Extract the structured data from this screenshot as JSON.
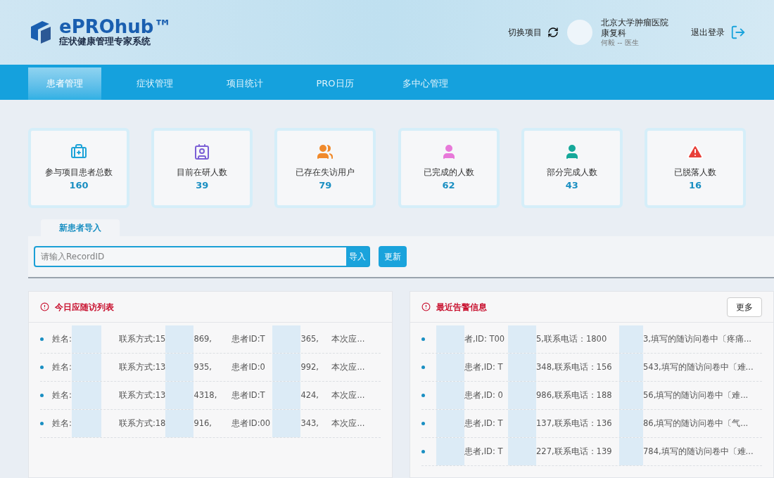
{
  "header": {
    "logo_title": "ePROhub™",
    "logo_subtitle": "症状健康管理专家系统",
    "switch_project": "切换项目",
    "hospital": "北京大学肿瘤医院",
    "department": "康复科",
    "user": "何毅 -- 医生",
    "logout": "退出登录"
  },
  "nav": [
    {
      "label": "患者管理",
      "selected": true
    },
    {
      "label": "症状管理",
      "selected": false
    },
    {
      "label": "项目统计",
      "selected": false
    },
    {
      "label": "PRO日历",
      "selected": false
    },
    {
      "label": "多中心管理",
      "selected": false
    }
  ],
  "stats": [
    {
      "kind": "kit",
      "color": "#1ea3d8",
      "label": "参与项目患者总数",
      "value": "160"
    },
    {
      "kind": "card",
      "color": "#7b5fd6",
      "label": "目前在研人数",
      "value": "39"
    },
    {
      "kind": "group",
      "color": "#f08a2c",
      "label": "已存在失访用户",
      "value": "79"
    },
    {
      "kind": "person",
      "color": "#e779d9",
      "label": "已完成的人数",
      "value": "62"
    },
    {
      "kind": "person",
      "color": "#16a89a",
      "label": "部分完成人数",
      "value": "43"
    },
    {
      "kind": "alert",
      "color": "#e8403a",
      "label": "已脱落人数",
      "value": "16"
    }
  ],
  "import": {
    "tab": "新患者导入",
    "placeholder": "请输入RecordID",
    "import_button": "导入",
    "update_button": "更新"
  },
  "followup": {
    "title": "今日应随访列表",
    "rows": [
      {
        "name": "姓名:",
        "contact": "联系方式:15",
        "contact_end": "869,",
        "id": "患者ID:T",
        "id_end": "365,",
        "summary": "本次应..."
      },
      {
        "name": "姓名:",
        "contact": "联系方式:13",
        "contact_end": "935,",
        "id": "患者ID:0",
        "id_end": "992,",
        "summary": "本次应..."
      },
      {
        "name": "姓名:",
        "contact": "联系方式:13",
        "contact_end": "4318,",
        "id": "患者ID:T",
        "id_end": "424,",
        "summary": "本次应..."
      },
      {
        "name": "姓名:",
        "contact": "联系方式:18",
        "contact_end": "916,",
        "id": "患者ID:00",
        "id_end": "343,",
        "summary": "本次应..."
      }
    ]
  },
  "alerts": {
    "title": "最近告警信息",
    "more": "更多",
    "rows": [
      {
        "start": "者,ID: T00",
        "mid": "5,联系电话：1800",
        "end": "3,填写的随访问卷中〔疼痛..."
      },
      {
        "start": "患者,ID: T",
        "mid": "348,联系电话：156",
        "end": "543,填写的随访问卷中〔难..."
      },
      {
        "start": "患者,ID: 0",
        "mid": "986,联系电话：188",
        "end": "56,填写的随访问卷中〔难..."
      },
      {
        "start": "患者,ID: T",
        "mid": "137,联系电话：136",
        "end": "86,填写的随访问卷中〔气..."
      },
      {
        "start": "患者,ID: T",
        "mid": "227,联系电话：139",
        "end": "784,填写的随访问卷中〔难..."
      }
    ]
  }
}
